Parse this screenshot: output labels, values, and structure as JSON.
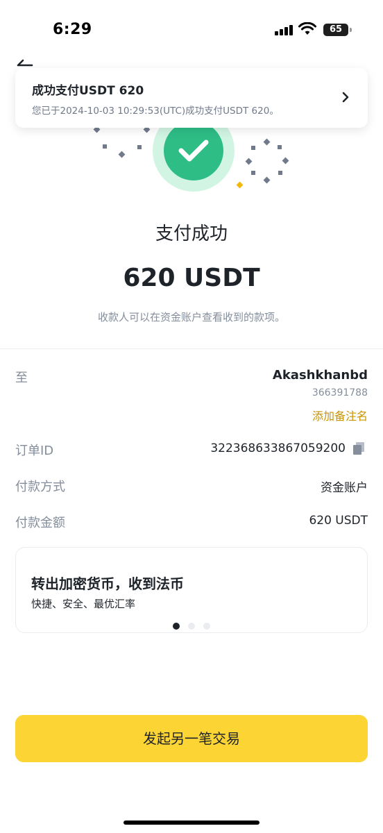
{
  "status_bar": {
    "time": "6:29",
    "battery": "65"
  },
  "notification": {
    "title": "成功支付USDT 620",
    "body": "您已于2024-10-03 10:29:53(UTC)成功支付USDT 620。"
  },
  "result": {
    "title": "支付成功",
    "amount": "620 USDT",
    "note": "收款人可以在资金账户查看收到的款项。"
  },
  "details": {
    "to_label": "至",
    "recipient_name": "Akashkhanbd",
    "recipient_id": "366391788",
    "add_note_label": "添加备注名",
    "order_label": "订单ID",
    "order_id": "322368633867059200",
    "method_label": "付款方式",
    "method_value": "资金账户",
    "amount_label": "付款金额",
    "amount_value": "620 USDT"
  },
  "promo": {
    "title": "转出加密货币，收到法币",
    "subtitle": "快捷、安全、最优汇率",
    "active_index": 0,
    "page_count": 3
  },
  "cta": {
    "label": "发起另一笔交易"
  },
  "colors": {
    "accent": "#fcd535",
    "success": "#2ebd85",
    "link": "#c99400",
    "text_primary": "#1e2329",
    "text_secondary": "#848e9c"
  }
}
